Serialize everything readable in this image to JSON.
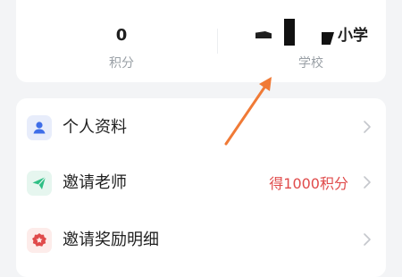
{
  "stats": {
    "points": {
      "value": "0",
      "label": "积分"
    },
    "school": {
      "value_suffix": "小学",
      "label": "学校"
    }
  },
  "menu": {
    "items": [
      {
        "label": "个人资料",
        "icon": "person-icon"
      },
      {
        "label": "邀请老师",
        "icon": "paper-plane-icon",
        "extra": "得1000积分"
      },
      {
        "label": "邀请奖励明细",
        "icon": "award-badge-icon"
      }
    ]
  },
  "colors": {
    "accent_blue": "#3f6ee8",
    "accent_green": "#2fbf85",
    "accent_red": "#e04b4b",
    "annotation_arrow": "#f07a36"
  }
}
